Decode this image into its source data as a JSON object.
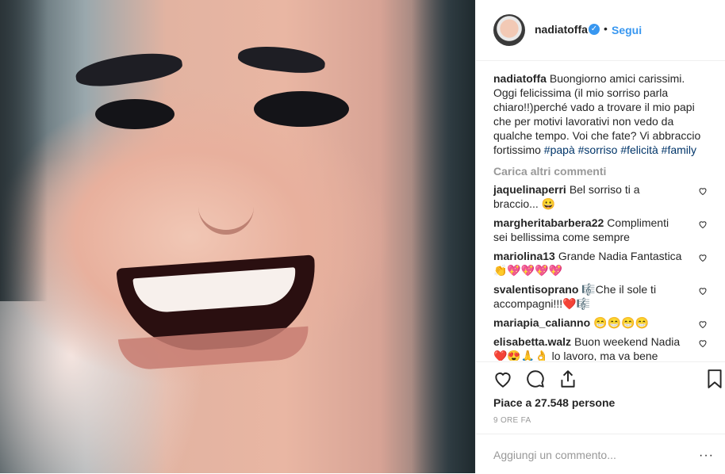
{
  "post": {
    "username": "nadiatoffa",
    "verified_icon": "verified-check-icon",
    "separator": "•",
    "follow_label": "Segui",
    "caption_text": "Buongiorno amici carissimi. Oggi felicissima (il mio sorriso parla chiaro!!)perché vado a trovare il mio papi che per motivi lavorativi non vedo da qualche tempo. Voi che fate? Vi abbraccio fortissimo",
    "hashtags": [
      "#papà",
      "#sorriso",
      "#felicità",
      "#family"
    ],
    "load_more_label": "Carica altri commenti",
    "comments": [
      {
        "user": "jaquelinaperri",
        "text": "Bel sorriso ti a braccio... 😀"
      },
      {
        "user": "margheritabarbera22",
        "text": "Complimenti sei bellissima come sempre"
      },
      {
        "user": "mariolina13",
        "text": "Grande Nadia Fantastica 👏💖💖💖💖"
      },
      {
        "user": "svalentisoprano",
        "text": "🎼Che il sole ti accompagni!!!❤️🎼"
      },
      {
        "user": "mariapia_calianno",
        "text": "😁😁😁😁"
      },
      {
        "user": "elisabetta.walz",
        "text": "Buon weekend Nadia ❤️😍🙏👌 lo lavoro, ma va bene"
      }
    ],
    "likes_text": "Piace a 27.548 persone",
    "time_text": "9 ORE FA",
    "add_comment_placeholder": "Aggiungi un commento...",
    "more_label": "···"
  }
}
